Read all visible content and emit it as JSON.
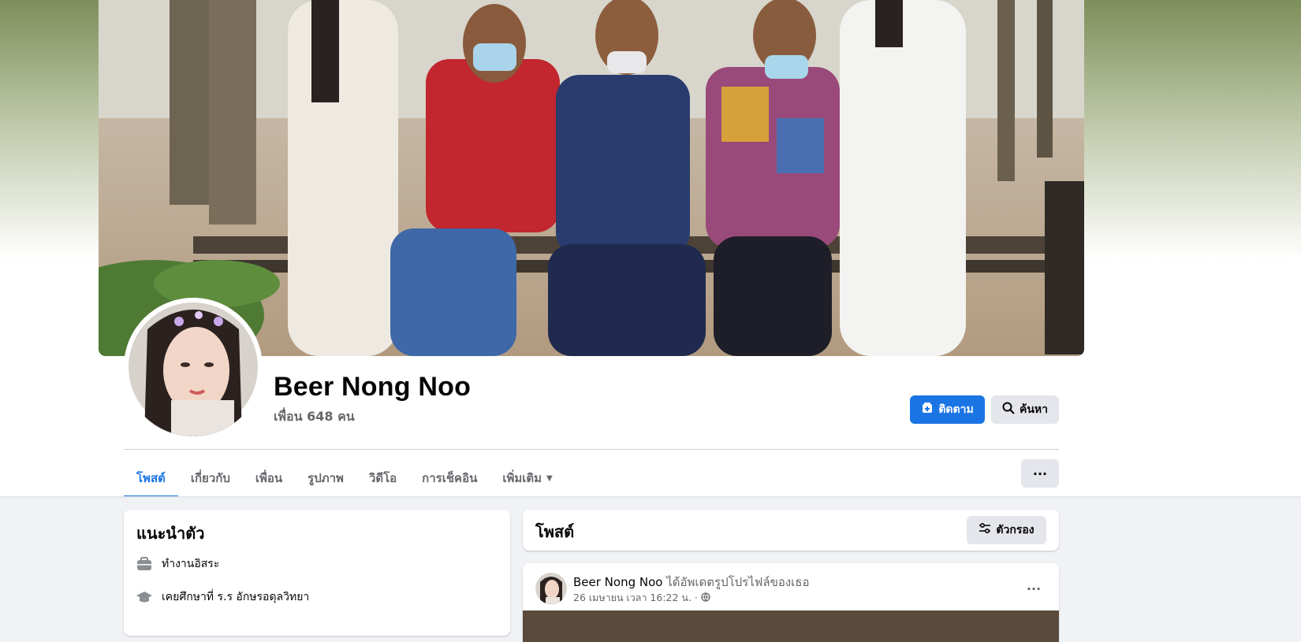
{
  "profile": {
    "name": "Beer Nong Noo",
    "friends_count": "เพื่อน 648 คน"
  },
  "actions": {
    "follow_label": "ติดตาม",
    "search_label": "ค้นหา",
    "more_label": "···"
  },
  "tabs": [
    {
      "label": "โพสต์",
      "active": true
    },
    {
      "label": "เกี่ยวกับ"
    },
    {
      "label": "เพื่อน"
    },
    {
      "label": "รูปภาพ"
    },
    {
      "label": "วิดีโอ"
    },
    {
      "label": "การเช็คอิน"
    },
    {
      "label": "เพิ่มเติม"
    }
  ],
  "intro": {
    "title": "แนะนำตัว",
    "items": [
      {
        "icon": "briefcase-icon",
        "text": "ทำงานอิสระ"
      },
      {
        "icon": "graduation-cap-icon",
        "text": "เคยศึกษาที่ ร.ร อักษรอดุลวิทยา"
      }
    ]
  },
  "posts": {
    "title": "โพสต์",
    "filter_label": "ตัวกรอง",
    "items": [
      {
        "author": "Beer Nong Noo",
        "action": "ได้อัพเดตรูปโปรไฟล์ของเธอ",
        "timestamp": "26 เมษายน เวลา 16:22 น. ·",
        "privacy_icon": "globe-icon",
        "more_label": "···"
      }
    ]
  },
  "colors": {
    "accent": "#1b74e4",
    "text_primary": "#050505",
    "text_secondary": "#65676b",
    "page_bg": "#f0f2f5",
    "button_gray": "#e4e6eb"
  }
}
